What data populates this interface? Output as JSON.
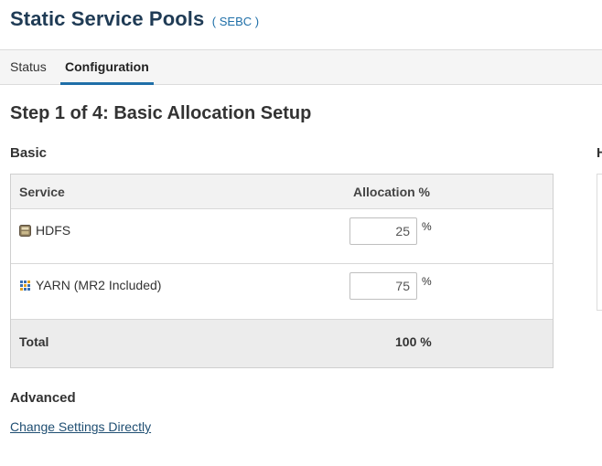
{
  "header": {
    "title": "Static Service Pools",
    "cluster_tag": "( SEBC )"
  },
  "tabs": [
    {
      "label": "Status",
      "active": false
    },
    {
      "label": "Configuration",
      "active": true
    }
  ],
  "step": {
    "title": "Step 1 of 4: Basic Allocation Setup"
  },
  "basic": {
    "label": "Basic",
    "columns": {
      "service": "Service",
      "allocation": "Allocation %"
    },
    "rows": [
      {
        "service": "HDFS",
        "icon": "hdfs-icon",
        "allocation": "25",
        "unit": "%"
      },
      {
        "service": "YARN (MR2 Included)",
        "icon": "yarn-icon",
        "allocation": "75",
        "unit": "%"
      }
    ],
    "total_label": "Total",
    "total_value": "100 %"
  },
  "side_panel": {
    "label": "H"
  },
  "advanced": {
    "label": "Advanced",
    "link": "Change Settings Directly"
  },
  "colors": {
    "title": "#1f3b55",
    "accent": "#1f6fa8",
    "link": "#1f4e72"
  }
}
